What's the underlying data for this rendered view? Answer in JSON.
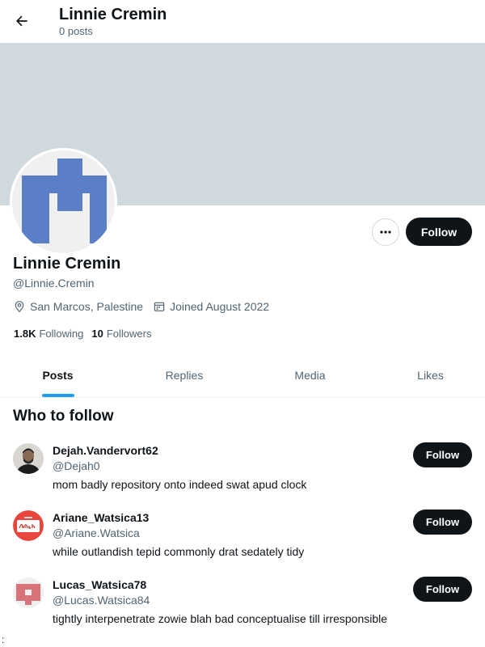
{
  "header": {
    "title": "Linnie Cremin",
    "subtitle": "0 posts",
    "back_icon": "arrow-left-icon"
  },
  "colors": {
    "banner": "#cfd9de",
    "primary_text": "#0f1419",
    "secondary_text": "#536471",
    "accent": "#1d9bf0",
    "button_bg": "#0f1419",
    "avatar_blue": "#5a7fc6"
  },
  "profile": {
    "name": "Linnie Cremin",
    "handle": "@Linnie.Cremin",
    "location": "San Marcos, Palestine",
    "joined": "Joined August 2022",
    "location_icon": "location-pin-icon",
    "calendar_icon": "calendar-icon",
    "following_count": "1.8K",
    "following_label": "Following",
    "followers_count": "10",
    "followers_label": "Followers",
    "follow_label": "Follow",
    "more_icon": "more-horizontal-icon"
  },
  "tabs": [
    {
      "label": "Posts",
      "active": true
    },
    {
      "label": "Replies",
      "active": false
    },
    {
      "label": "Media",
      "active": false
    },
    {
      "label": "Likes",
      "active": false
    }
  ],
  "who_to_follow": {
    "title": "Who to follow",
    "items": [
      {
        "name": "Dejah.Vandervort62",
        "handle": "@Dejah0",
        "bio": "mom badly repository onto indeed swat apud clock",
        "follow_label": "Follow"
      },
      {
        "name": "Ariane_Watsica13",
        "handle": "@Ariane.Watsica",
        "bio": "while outlandish tepid commonly drat sedately tidy",
        "follow_label": "Follow"
      },
      {
        "name": "Lucas_Watsica78",
        "handle": "@Lucas.Watsica84",
        "bio": "tightly interpenetrate zowie blah bad conceptualise till irresponsible",
        "follow_label": "Follow"
      }
    ]
  },
  "footer_mark": ":"
}
